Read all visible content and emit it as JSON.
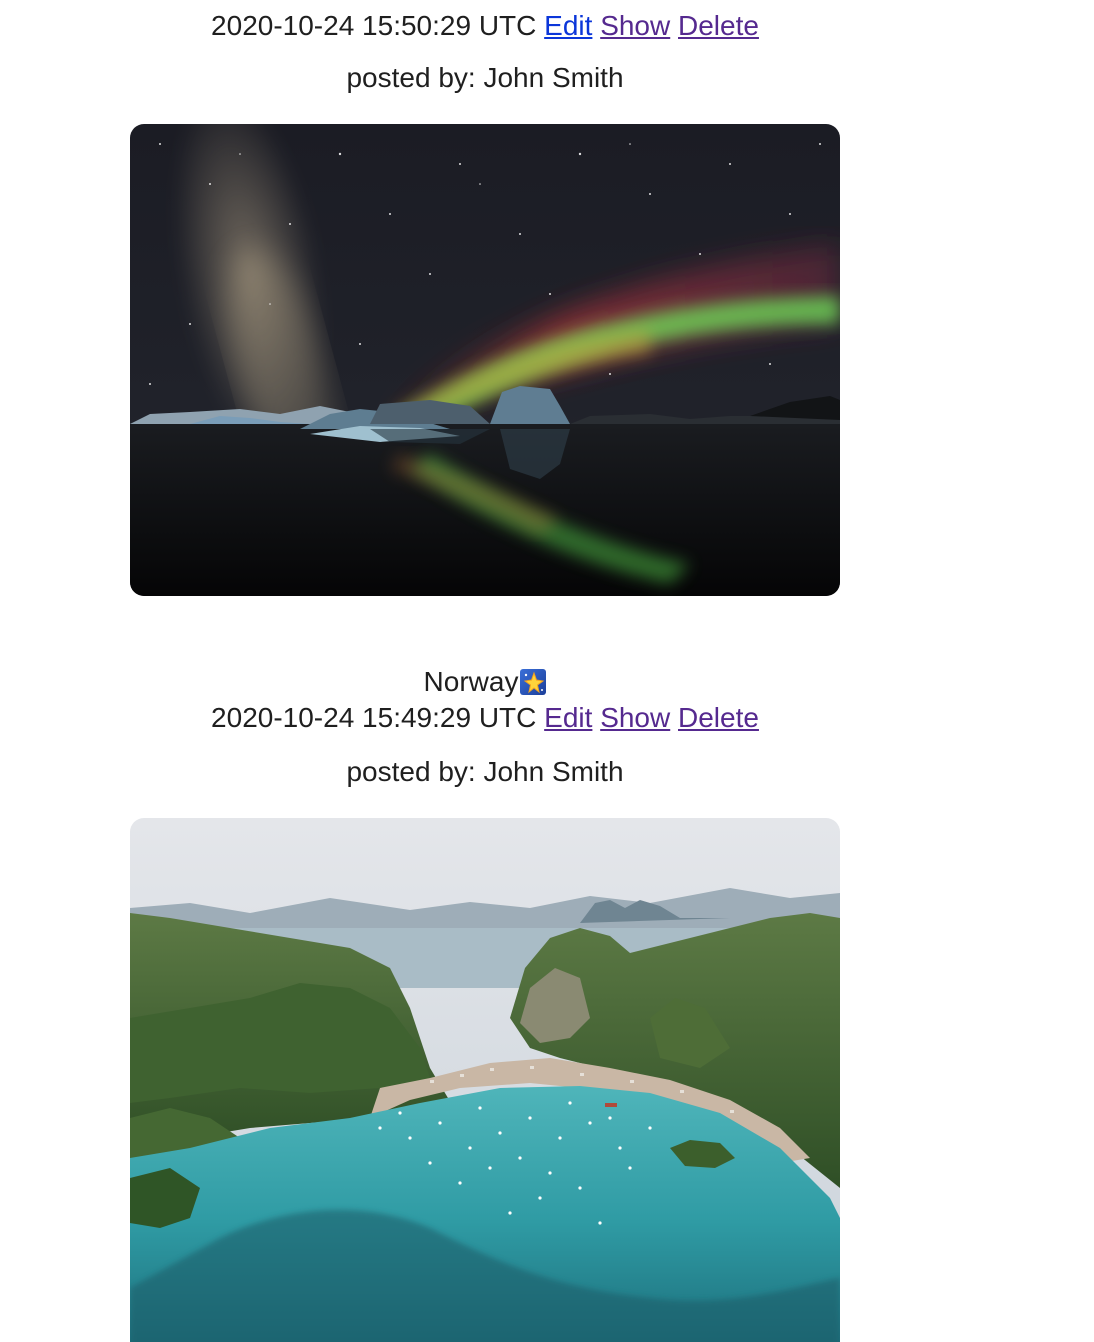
{
  "posts": [
    {
      "title": "",
      "timestamp": "2020-10-24 15:50:29 UTC",
      "links": {
        "edit": "Edit",
        "show": "Show",
        "delete": "Delete"
      },
      "posted_by": "posted by: John Smith",
      "image_alt": "Aurora borealis and Milky Way over icebergs reflected in water"
    },
    {
      "title": "Norway",
      "title_icon": "sparkle-star-emoji-icon",
      "timestamp": "2020-10-24 15:49:29 UTC",
      "links": {
        "edit": "Edit",
        "show": "Show",
        "delete": "Delete"
      },
      "posted_by": "posted by: John Smith",
      "image_alt": "Aerial view of a tropical bay with boats and green mountains"
    }
  ],
  "colors": {
    "link": "#0b36d9",
    "visited_link": "#55298f",
    "text": "#1f1f1f"
  }
}
